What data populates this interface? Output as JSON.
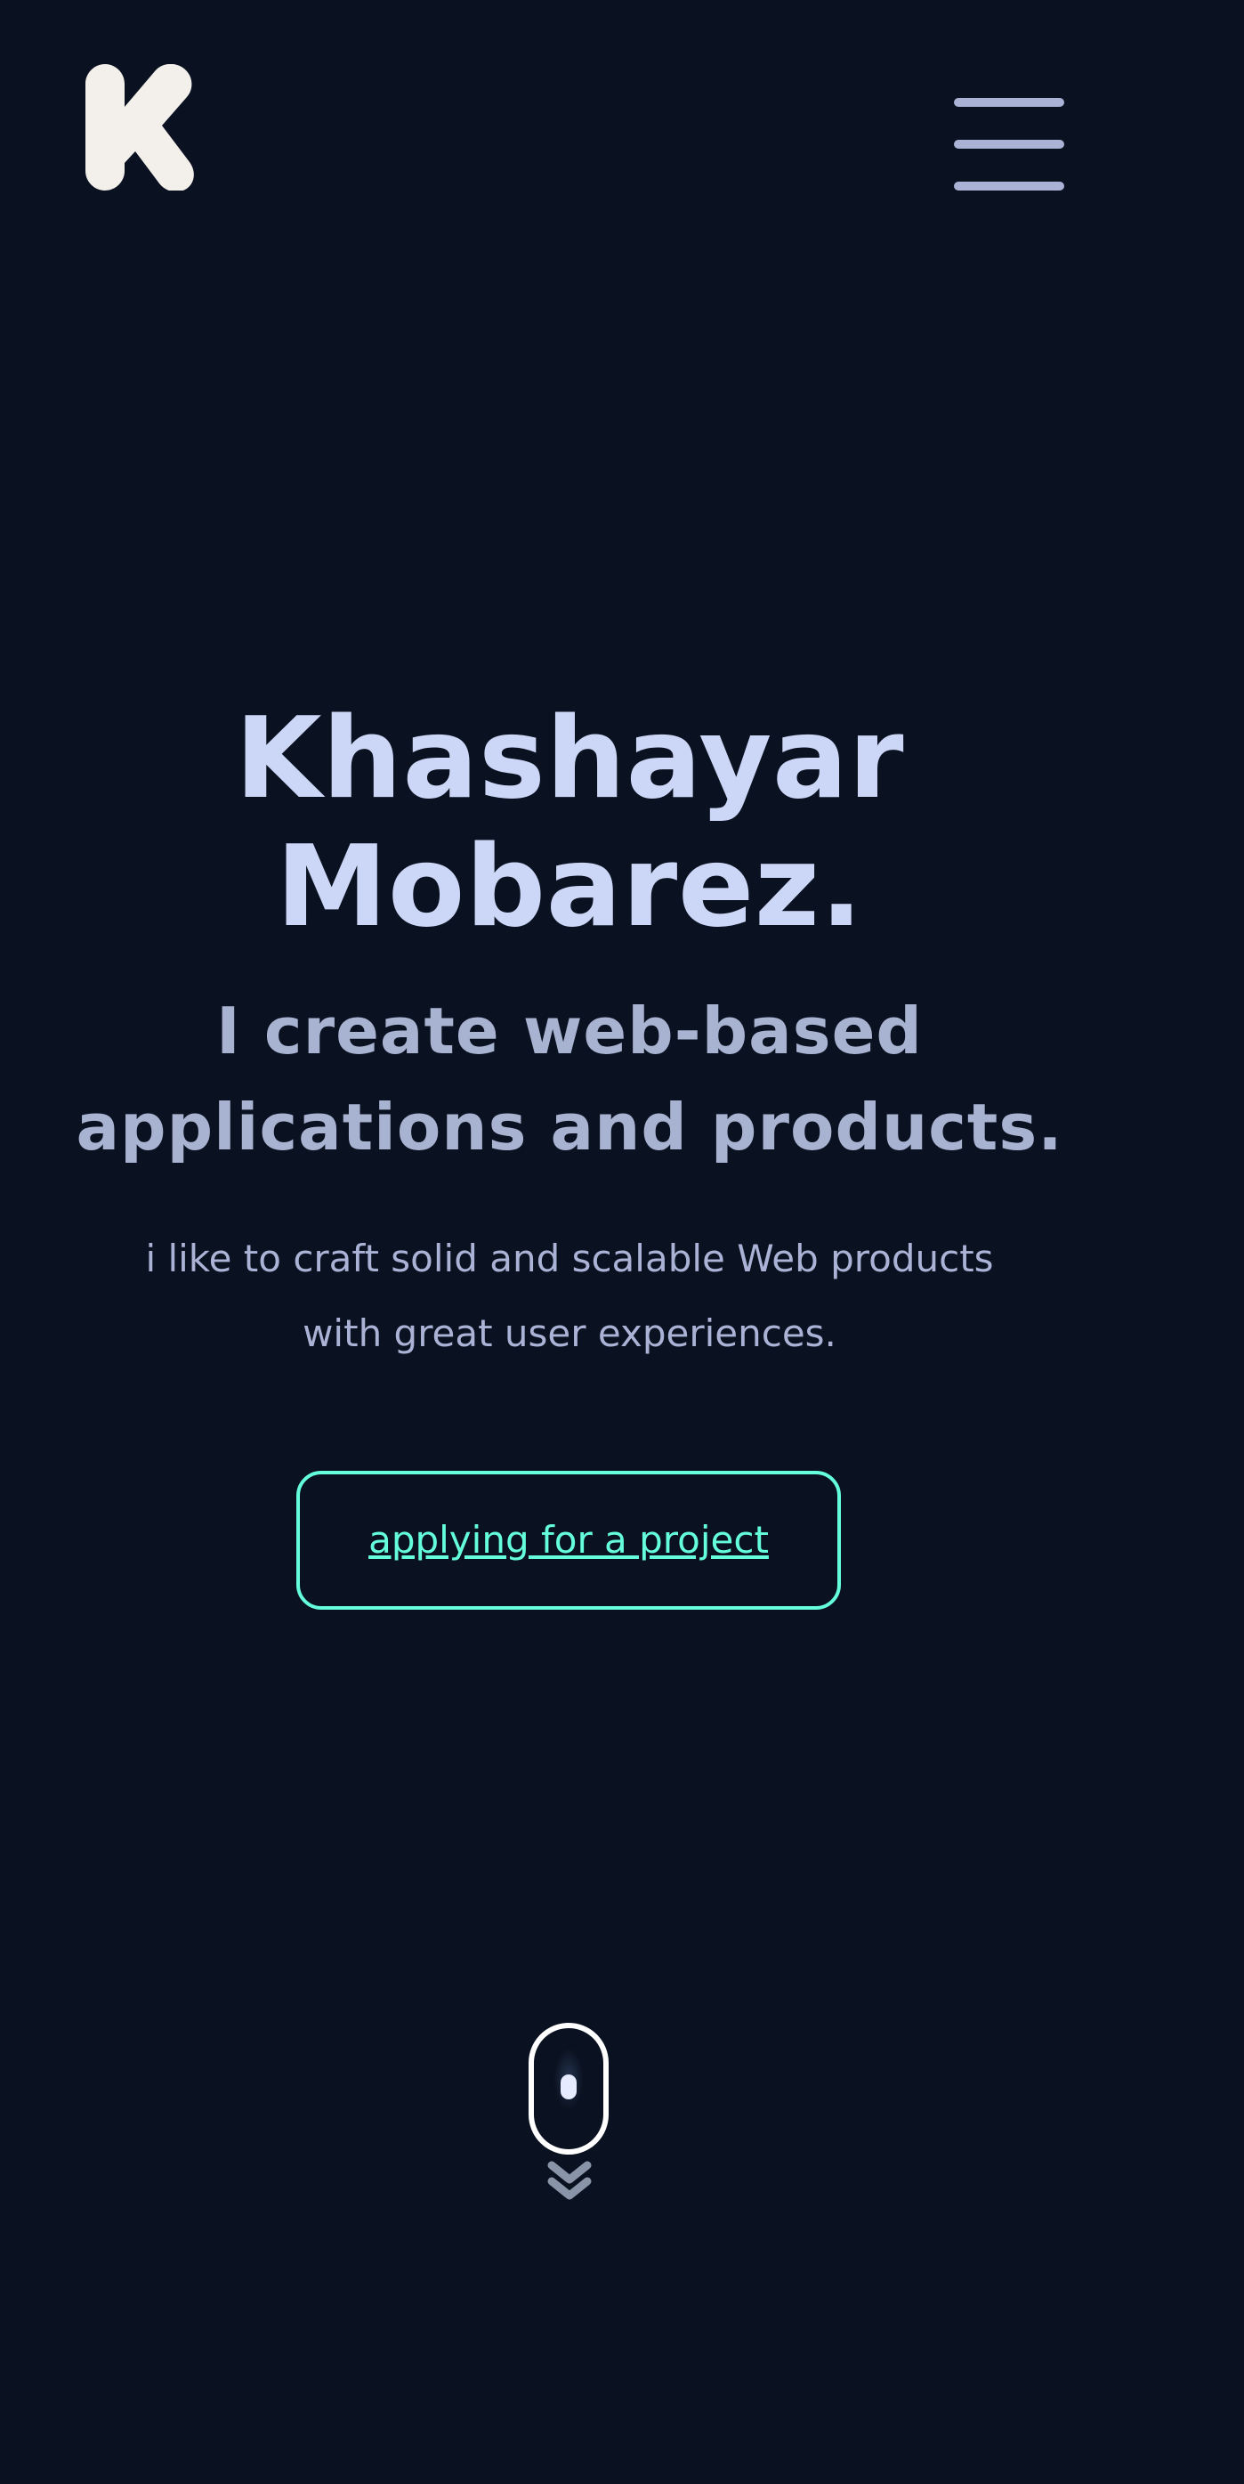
{
  "header": {
    "logo_letter": "K",
    "logo_icon": "k-logo-icon",
    "menu_icon": "hamburger-menu-icon"
  },
  "hero": {
    "name_line_1": "Khashayar",
    "name_line_2": "Mobarez.",
    "tagline_line_1": "I create web-based",
    "tagline_line_2": "applications and products.",
    "description_line_1": "i like to craft solid and scalable Web products",
    "description_line_2": "with great user experiences.",
    "cta_label": "applying for a project"
  },
  "scroll_indicator": {
    "mouse_icon": "mouse-scroll-icon",
    "chevron_icon": "double-chevron-down-icon"
  },
  "colors": {
    "background": "#0a1120",
    "name": "#ccd6f6",
    "tagline": "#a8b2d1",
    "description": "#aab3d6",
    "accent": "#64ffda",
    "logo": "#f3f0ec",
    "menu": "#aab3d6"
  }
}
